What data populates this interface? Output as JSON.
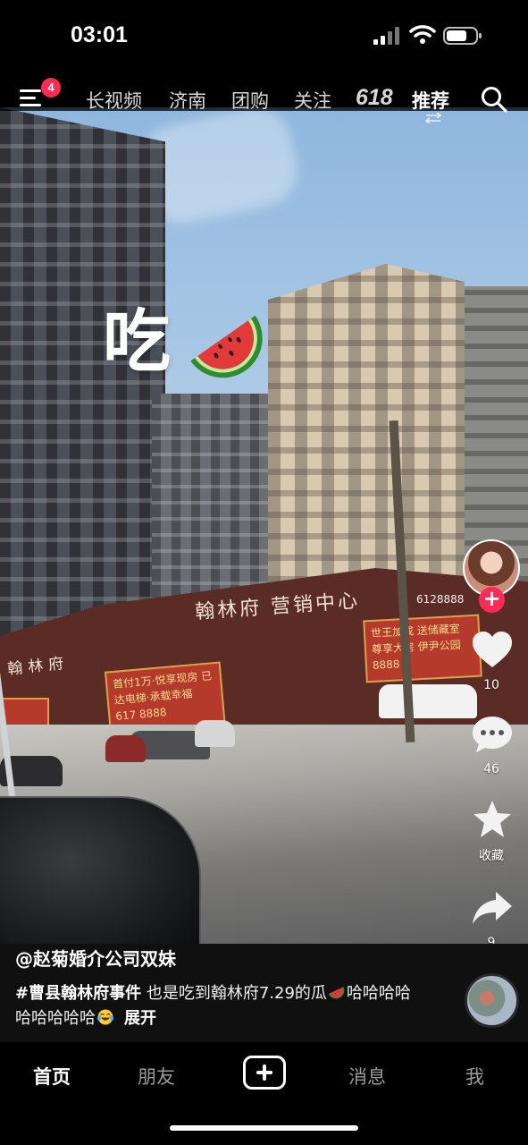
{
  "status_bar": {
    "time": "03:01"
  },
  "top_nav": {
    "menu_badge": "4",
    "tabs": [
      {
        "label": "长视频",
        "active": false
      },
      {
        "label": "济南",
        "active": false
      },
      {
        "label": "团购",
        "active": false
      },
      {
        "label": "关注",
        "active": false
      },
      {
        "label": "618",
        "active": false
      },
      {
        "label": "推荐",
        "active": true
      }
    ]
  },
  "video": {
    "overlay_text": "吃",
    "overlay_emoji": "watermelon-icon",
    "scene": {
      "sign_main": "翰林府 营销中心",
      "sign_left": "翰林府",
      "banner_left": "首付1万·悦享现房 已达电梯·承载幸福 617 8888",
      "banner_right": "世王加成 送储藏室 尊享大房 伊尹公园 8888",
      "phone": "6128888"
    }
  },
  "actions": {
    "follow_symbol": "+",
    "like_count": "10",
    "comment_count": "46",
    "favorite_label": "收藏",
    "share_count": "9"
  },
  "caption": {
    "author": "@赵菊婚介公司双妹",
    "hashtag": "#曹县翰林府事件",
    "text": " 也是吃到翰林府7.29的瓜",
    "text2": "哈哈哈哈哈哈哈哈哈",
    "expand": "展开"
  },
  "bottom_nav": {
    "items": [
      {
        "label": "首页",
        "active": true
      },
      {
        "label": "朋友",
        "active": false
      },
      {
        "label": "消息",
        "active": false
      },
      {
        "label": "我",
        "active": false
      }
    ]
  },
  "colors": {
    "accent": "#fe2c55",
    "background": "#000000"
  }
}
